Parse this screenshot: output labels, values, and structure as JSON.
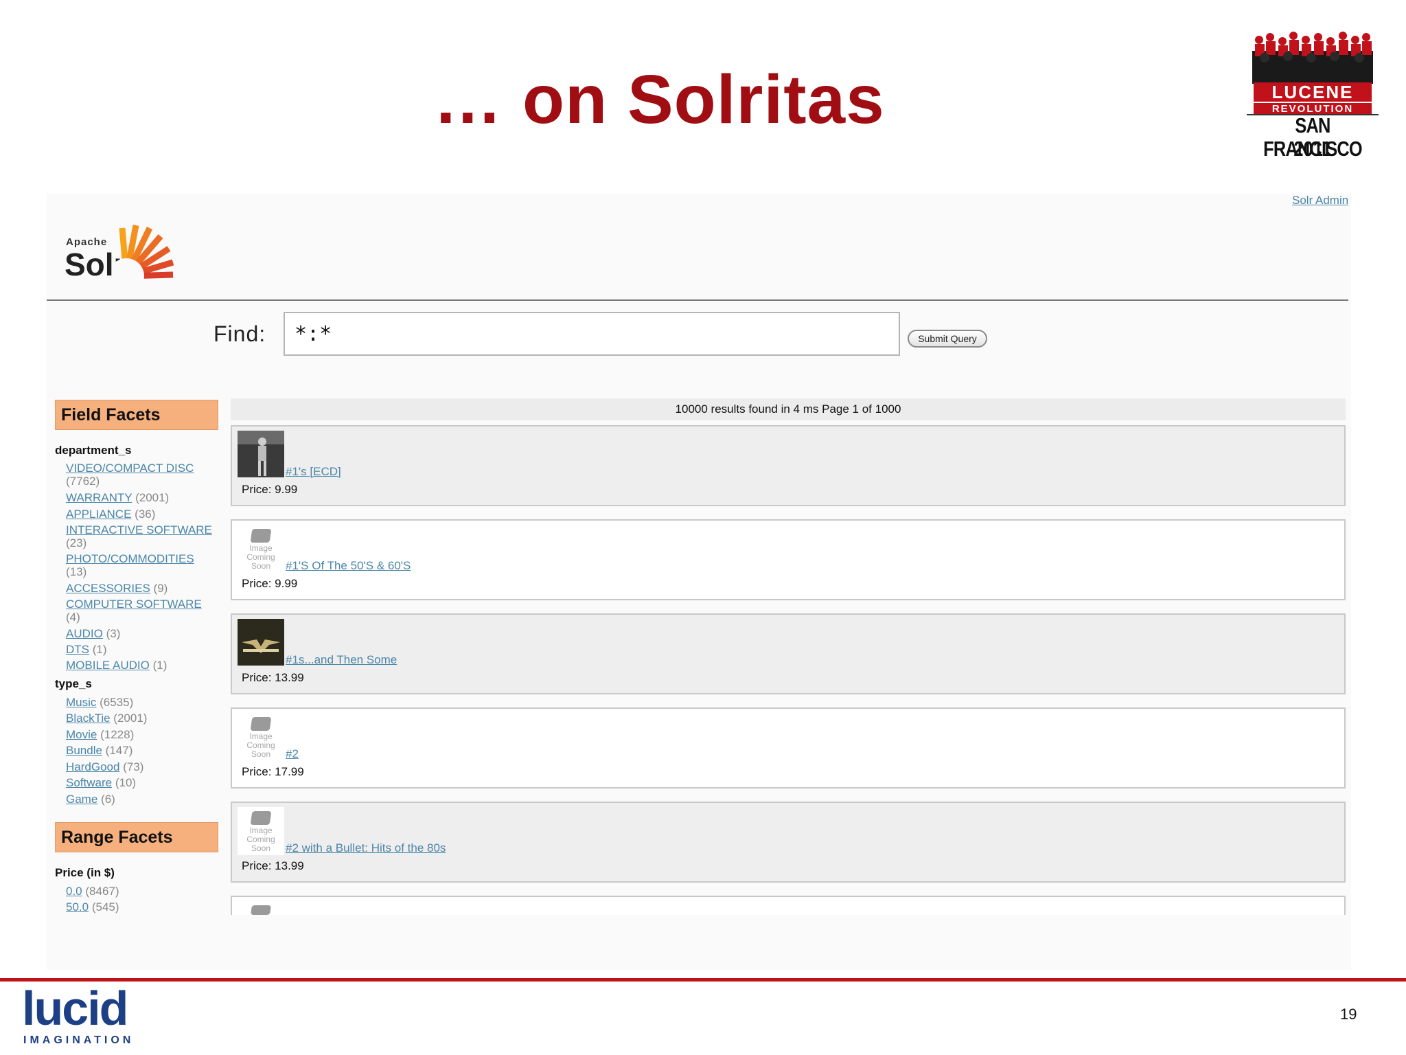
{
  "slide": {
    "title": "… on Solritas",
    "page_number": "19"
  },
  "conference_logo": {
    "line1": "LUCENE",
    "line2": "REVOLUTION",
    "city": "SAN FRANCISCO",
    "year": "2011"
  },
  "footer_logo": {
    "name": "lucid",
    "sub": "IMAGINATION"
  },
  "solr_app": {
    "admin_link": "Solr Admin",
    "logo_apache": "Apache",
    "logo_name": "Solr",
    "find_label": "Find:",
    "query_value": "*:*",
    "submit_label": "Submit Query",
    "results_summary": "10000 results found in 4 ms Page 1 of 1000",
    "field_facets_header": "Field Facets",
    "range_facets_header": "Range Facets",
    "department_field": "department_s",
    "department_items": [
      {
        "label": "VIDEO/COMPACT DISC",
        "count": "(7762)"
      },
      {
        "label": "WARRANTY",
        "count": "(2001)"
      },
      {
        "label": "APPLIANCE",
        "count": "(36)"
      },
      {
        "label": "INTERACTIVE SOFTWARE",
        "count": "(23)"
      },
      {
        "label": "PHOTO/COMMODITIES",
        "count": "(13)"
      },
      {
        "label": "ACCESSORIES",
        "count": "(9)"
      },
      {
        "label": "COMPUTER SOFTWARE",
        "count": "(4)"
      },
      {
        "label": "AUDIO",
        "count": "(3)"
      },
      {
        "label": "DTS",
        "count": "(1)"
      },
      {
        "label": "MOBILE AUDIO",
        "count": "(1)"
      }
    ],
    "type_field": "type_s",
    "type_items": [
      {
        "label": "Music",
        "count": "(6535)"
      },
      {
        "label": "BlackTie",
        "count": "(2001)"
      },
      {
        "label": "Movie",
        "count": "(1228)"
      },
      {
        "label": "Bundle",
        "count": "(147)"
      },
      {
        "label": "HardGood",
        "count": "(73)"
      },
      {
        "label": "Software",
        "count": "(10)"
      },
      {
        "label": "Game",
        "count": "(6)"
      }
    ],
    "price_field": "Price (in $)",
    "price_items": [
      {
        "label": "0.0",
        "count": "(8467)"
      },
      {
        "label": "50.0",
        "count": "(545)"
      }
    ],
    "placeholder_text": {
      "l1": "Image",
      "l2": "Coming",
      "l3": "Soon"
    },
    "results": [
      {
        "title": "#1's [ECD]",
        "price": "Price: 9.99",
        "image": "album-photo"
      },
      {
        "title": "#1'S Of The 50'S & 60'S",
        "price": "Price: 9.99",
        "image": "placeholder"
      },
      {
        "title": "#1s...and Then Some",
        "price": "Price: 13.99",
        "image": "album-photo"
      },
      {
        "title": "#2",
        "price": "Price: 17.99",
        "image": "placeholder"
      },
      {
        "title": "#2 with a Bullet: Hits of the 80s",
        "price": "Price: 13.99",
        "image": "placeholder"
      }
    ]
  }
}
